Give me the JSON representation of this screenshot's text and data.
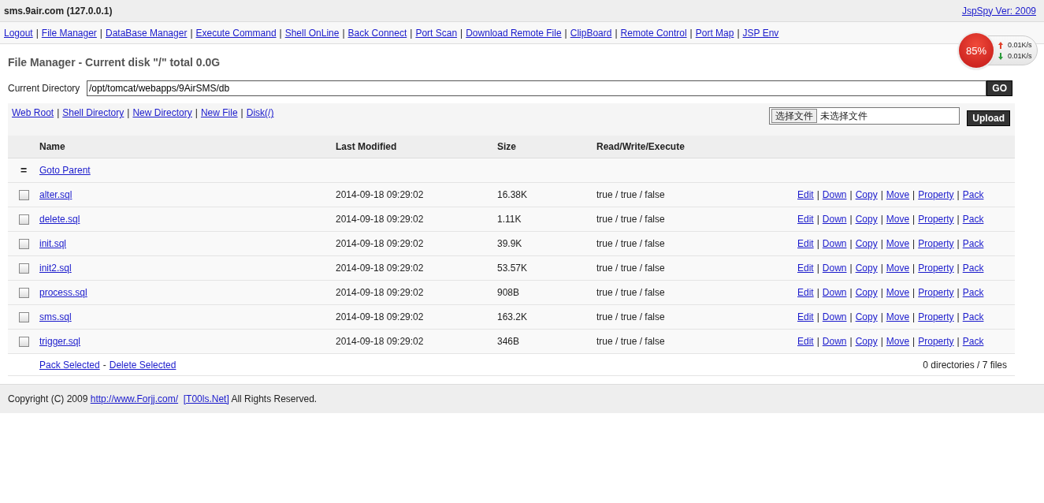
{
  "header": {
    "title": "sms.9air.com (127.0.0.1)",
    "version_link": "JspSpy Ver: 2009"
  },
  "nav": {
    "separator": "|",
    "links": [
      "Logout",
      "File Manager",
      "DataBase Manager",
      "Execute Command",
      "Shell OnLine",
      "Back Connect",
      "Port Scan",
      "Download Remote File",
      "ClipBoard",
      "Remote Control",
      "Port Map",
      "JSP Env"
    ]
  },
  "network_widget": {
    "percent": "85%",
    "upload": "0.01K/s",
    "download": "0.01K/s"
  },
  "heading": "File Manager - Current disk \"/\" total 0.0G",
  "directory": {
    "label": "Current Directory",
    "value": "/opt/tomcat/webapps/9AirSMS/db",
    "button": "GO"
  },
  "tools": {
    "separator": "|",
    "links": [
      "Web Root",
      "Shell Directory",
      "New Directory",
      "New File",
      "Disk(/)"
    ]
  },
  "upload": {
    "choose_button": "选择文件",
    "status": "未选择文件",
    "button": "Upload"
  },
  "table": {
    "columns": [
      "Name",
      "Last Modified",
      "Size",
      "Read/Write/Execute"
    ],
    "parent": {
      "icon": "=",
      "link": "Goto Parent"
    },
    "action_separator": "|",
    "rows": [
      {
        "name": "alter.sql",
        "modified": "2014-09-18 09:29:02",
        "size": "16.38K",
        "rwx": "true / true / false",
        "checked": false,
        "actions": [
          "Edit",
          "Down",
          "Copy",
          "Move",
          "Property",
          "Pack"
        ]
      },
      {
        "name": "delete.sql",
        "modified": "2014-09-18 09:29:02",
        "size": "1.11K",
        "rwx": "true / true / false",
        "checked": false,
        "actions": [
          "Edit",
          "Down",
          "Copy",
          "Move",
          "Property",
          "Pack"
        ]
      },
      {
        "name": "init.sql",
        "modified": "2014-09-18 09:29:02",
        "size": "39.9K",
        "rwx": "true / true / false",
        "checked": false,
        "actions": [
          "Edit",
          "Down",
          "Copy",
          "Move",
          "Property",
          "Pack"
        ]
      },
      {
        "name": "init2.sql",
        "modified": "2014-09-18 09:29:02",
        "size": "53.57K",
        "rwx": "true / true / false",
        "checked": false,
        "actions": [
          "Edit",
          "Down",
          "Copy",
          "Move",
          "Property",
          "Pack"
        ]
      },
      {
        "name": "process.sql",
        "modified": "2014-09-18 09:29:02",
        "size": "908B",
        "rwx": "true / true / false",
        "checked": false,
        "actions": [
          "Edit",
          "Down",
          "Copy",
          "Move",
          "Property",
          "Pack"
        ]
      },
      {
        "name": "sms.sql",
        "modified": "2014-09-18 09:29:02",
        "size": "163.2K",
        "rwx": "true / true / false",
        "checked": false,
        "actions": [
          "Edit",
          "Down",
          "Copy",
          "Move",
          "Property",
          "Pack"
        ]
      },
      {
        "name": "trigger.sql",
        "modified": "2014-09-18 09:29:02",
        "size": "346B",
        "rwx": "true / true / false",
        "checked": false,
        "actions": [
          "Edit",
          "Down",
          "Copy",
          "Move",
          "Property",
          "Pack"
        ]
      }
    ],
    "footer": {
      "pack_link": "Pack Selected",
      "dash": "-",
      "delete_link": "Delete Selected",
      "summary": "0 directories / 7 files"
    }
  },
  "copyright": {
    "before": "Copyright (C) 2009",
    "link1": "http://www.Forjj.com/",
    "link2": "[T00ls.Net]",
    "after": "All Rights Reserved."
  }
}
